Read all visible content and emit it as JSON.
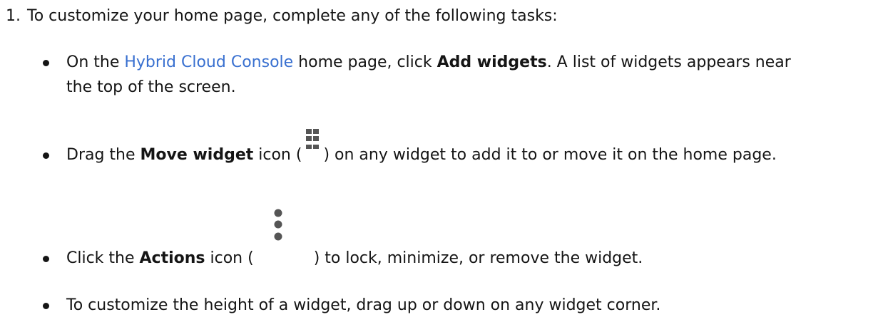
{
  "step": {
    "number": "1.",
    "text": "To customize your home page, complete any of the following tasks:"
  },
  "items": [
    {
      "pre": "On the ",
      "link": "Hybrid Cloud Console",
      "mid": " home page, click ",
      "bold": "Add widgets",
      "post": ". A list of widgets appears near",
      "line2": "the top of the screen."
    },
    {
      "pre": "Drag the ",
      "bold": "Move widget",
      "mid": " icon (",
      "icon": "drag-grip-icon",
      "post": ") on any widget to add it to or move it on the home page."
    },
    {
      "pre": "Click the ",
      "bold": "Actions",
      "mid": " icon (",
      "icon": "kebab-vertical-icon",
      "post": ") to lock, minimize, or remove the widget."
    },
    {
      "text": "To customize the height of a widget, drag up or down on any widget corner."
    }
  ],
  "colors": {
    "text": "#151515",
    "link": "#3970d0",
    "icon": "#555555"
  }
}
